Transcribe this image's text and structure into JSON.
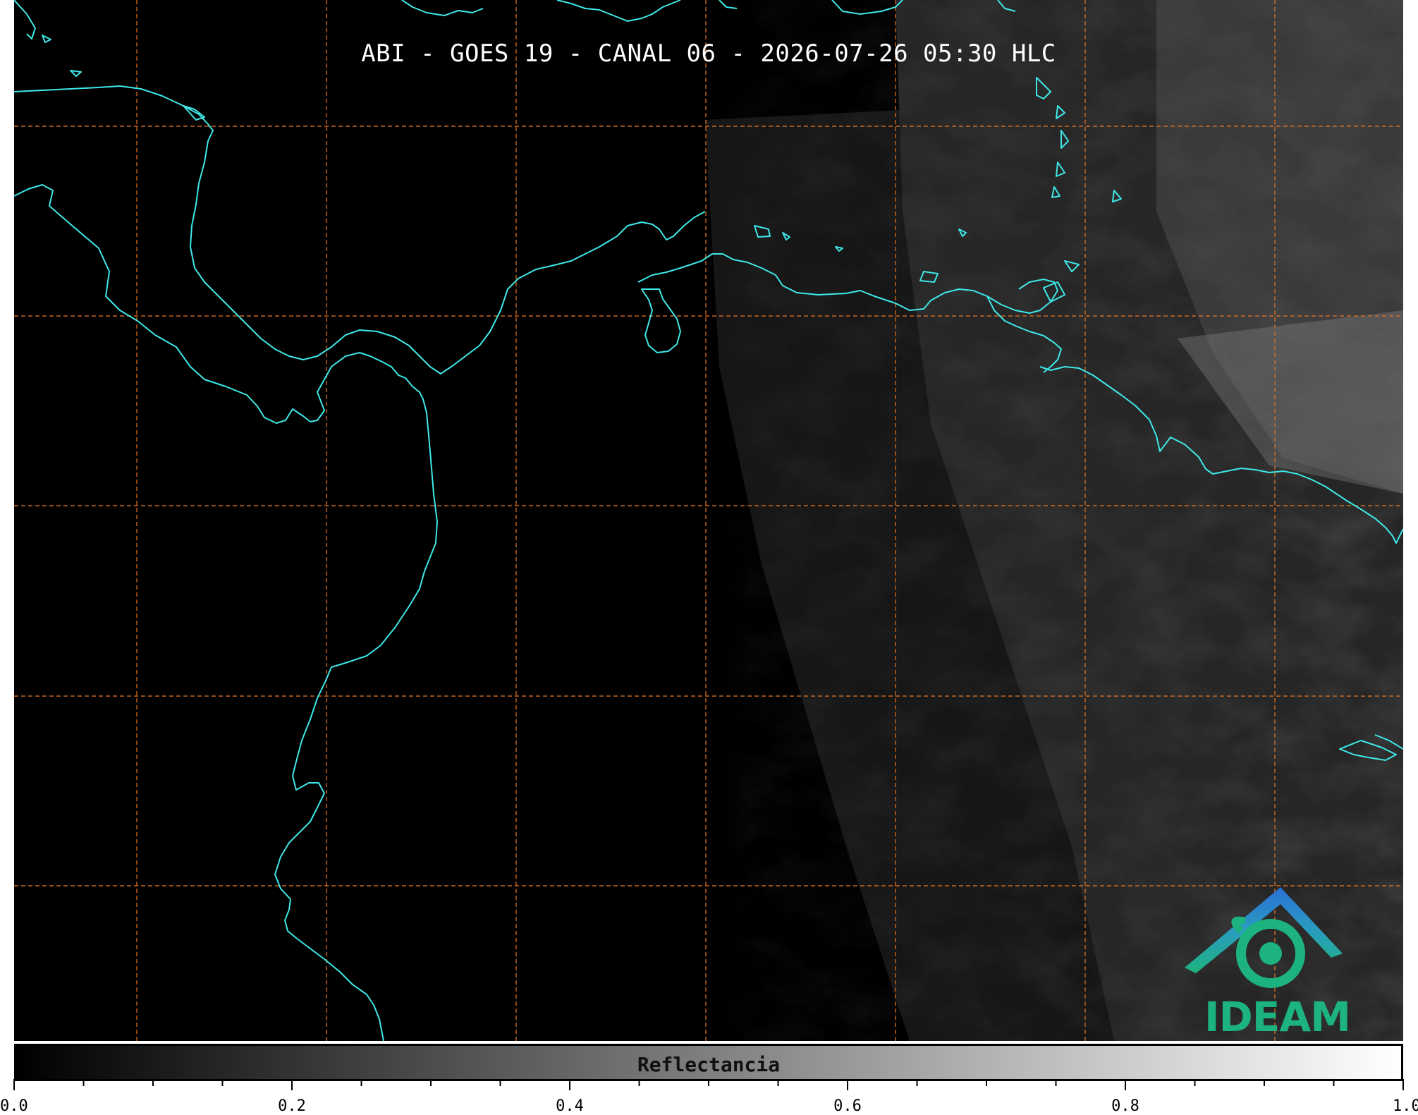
{
  "header": {
    "title": "ABI - GOES 19 - CANAL 06 - 2026-07-26 05:30 HLC"
  },
  "logo": {
    "text": "IDEAM",
    "icon": "ideam-mountain-swirl-icon"
  },
  "colorbar": {
    "label": "Reflectancia",
    "range": [
      0.0,
      1.0
    ],
    "tick_labels": [
      "0.0",
      "0.2",
      "0.4",
      "0.6",
      "0.8",
      "1.0"
    ],
    "colors": {
      "low": "#000000",
      "high": "#ffffff"
    }
  },
  "colors": {
    "coastline": "#3fe8e8",
    "graticule": "#e07020",
    "background": "#000000",
    "logo_blue": "#2a7fd0",
    "logo_green": "#1db37e"
  }
}
